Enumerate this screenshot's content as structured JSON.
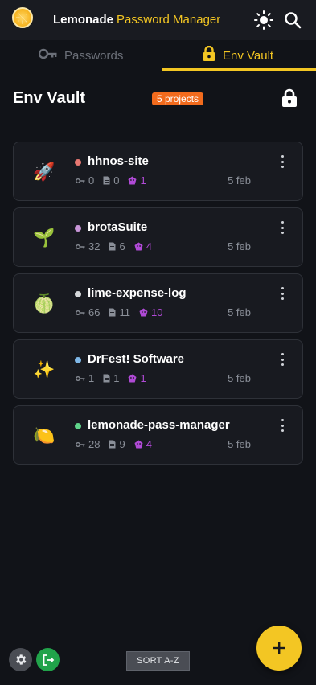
{
  "app": {
    "title": "Lemonade",
    "title_accent": "Password Manager"
  },
  "tabs": [
    {
      "label": "Passwords",
      "icon": "key-icon",
      "active": false
    },
    {
      "label": "Env Vault",
      "icon": "lock-icon",
      "active": true
    }
  ],
  "page": {
    "title": "Env Vault",
    "badge": "5 projects"
  },
  "projects": [
    {
      "emoji": "🚀",
      "dot": "#e87872",
      "name": "hhnos-site",
      "keys": "0",
      "files": "0",
      "members": "1",
      "date": "5 feb"
    },
    {
      "emoji": "🌱",
      "dot": "#c896d8",
      "name": "brotaSuite",
      "keys": "32",
      "files": "6",
      "members": "4",
      "date": "5 feb"
    },
    {
      "emoji": "🍈",
      "dot": "#d5d7da",
      "name": "lime-expense-log",
      "keys": "66",
      "files": "11",
      "members": "10",
      "date": "5 feb"
    },
    {
      "emoji": "✨",
      "dot": "#7fb8e8",
      "name": "DrFest! Software",
      "keys": "1",
      "files": "1",
      "members": "1",
      "date": "5 feb"
    },
    {
      "emoji": "🍋",
      "dot": "#5fd48a",
      "name": "lemonade-pass-manager",
      "keys": "28",
      "files": "9",
      "members": "4",
      "date": "5 feb"
    }
  ],
  "footer": {
    "sort_label": "SORT A-Z"
  },
  "colors": {
    "accent": "#f3c623",
    "badge": "#f26b1d",
    "members": "#b04ad6",
    "logout": "#21a34a",
    "background": "#111318"
  }
}
